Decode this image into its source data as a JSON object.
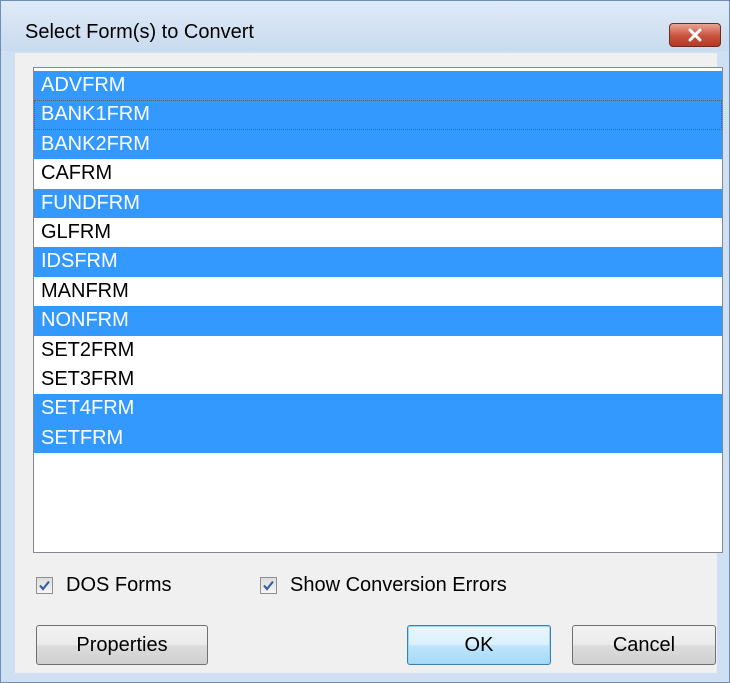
{
  "window": {
    "title": "Select Form(s) to Convert",
    "close_icon": "close-x-icon"
  },
  "forms_list": {
    "items": [
      {
        "label": "ADVFRM",
        "selected": true,
        "focused": false
      },
      {
        "label": "BANK1FRM",
        "selected": true,
        "focused": true
      },
      {
        "label": "BANK2FRM",
        "selected": true,
        "focused": false
      },
      {
        "label": "CAFRM",
        "selected": false,
        "focused": false
      },
      {
        "label": "FUNDFRM",
        "selected": true,
        "focused": false
      },
      {
        "label": "GLFRM",
        "selected": false,
        "focused": false
      },
      {
        "label": "IDSFRM",
        "selected": true,
        "focused": false
      },
      {
        "label": "MANFRM",
        "selected": false,
        "focused": false
      },
      {
        "label": "NONFRM",
        "selected": true,
        "focused": false
      },
      {
        "label": "SET2FRM",
        "selected": false,
        "focused": false
      },
      {
        "label": "SET3FRM",
        "selected": false,
        "focused": false
      },
      {
        "label": "SET4FRM",
        "selected": true,
        "focused": false
      },
      {
        "label": "SETFRM",
        "selected": true,
        "focused": false
      }
    ],
    "selection_color": "#3399ff"
  },
  "options": {
    "dos_forms": {
      "label": "DOS Forms",
      "checked": true
    },
    "show_errors": {
      "label": "Show Conversion Errors",
      "checked": true
    }
  },
  "buttons": {
    "properties": "Properties",
    "ok": "OK",
    "cancel": "Cancel"
  }
}
